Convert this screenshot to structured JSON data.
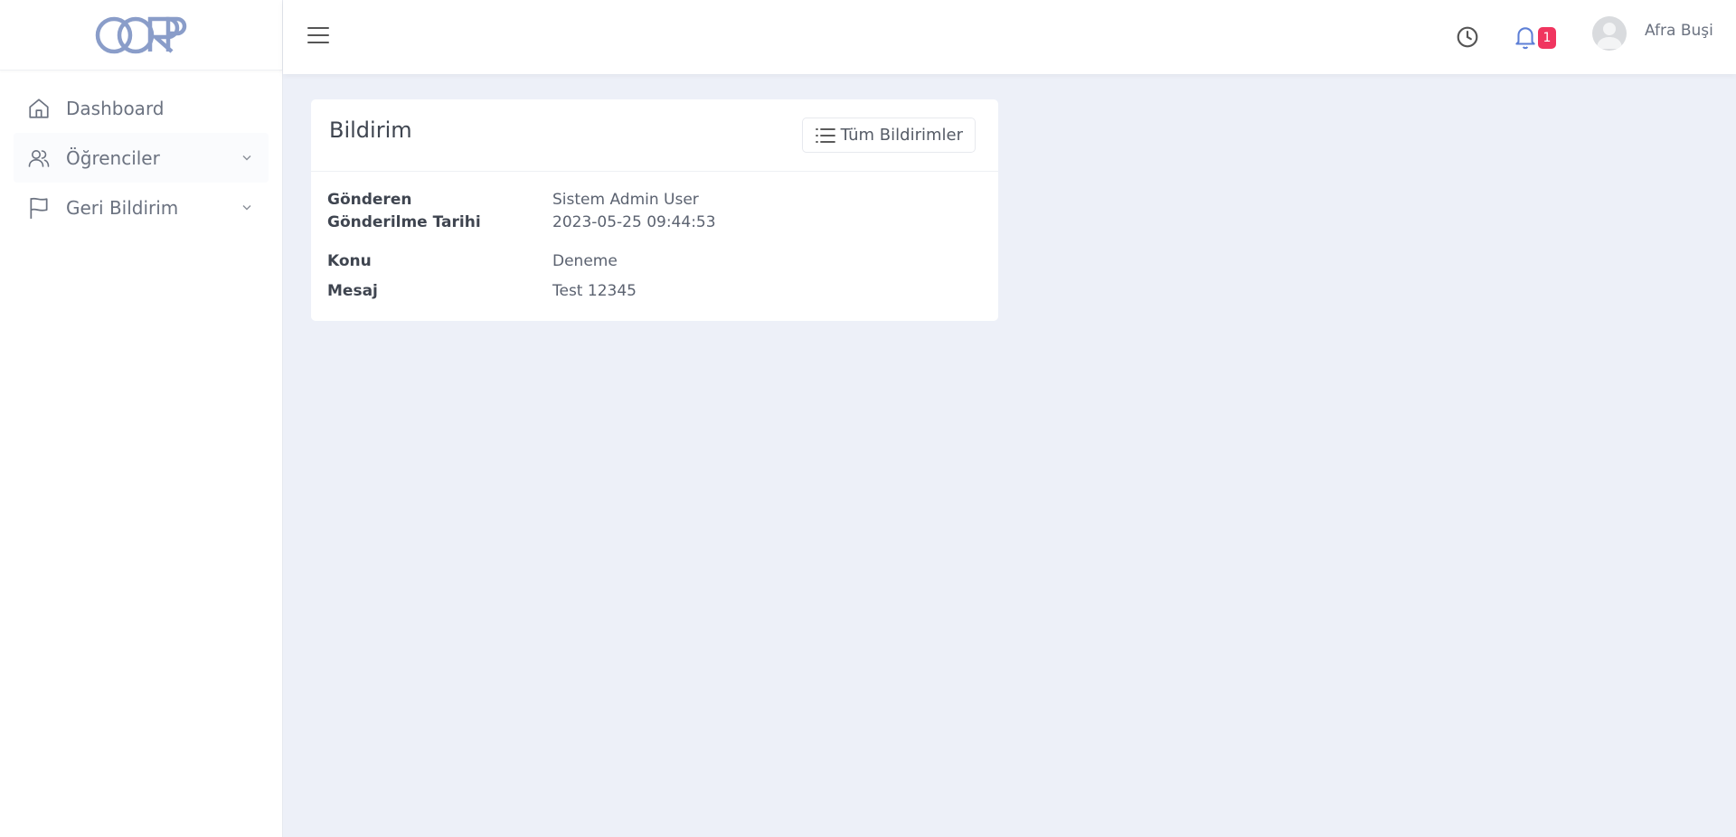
{
  "sidebar": {
    "items": [
      {
        "label": "Dashboard",
        "icon": "home-icon"
      },
      {
        "label": "Öğrenciler",
        "icon": "users-icon"
      },
      {
        "label": "Geri Bildirim",
        "icon": "flag-icon"
      }
    ]
  },
  "header": {
    "notification_count": "1",
    "user_name": "Afra Buşi"
  },
  "card": {
    "title": "Bildirim",
    "button_label": "Tüm Bildirimler",
    "fields": [
      {
        "key": "Gönderen",
        "value": "Sistem Admin User"
      },
      {
        "key": "Gönderilme Tarihi",
        "value": "2023-05-25 09:44:53"
      },
      {
        "key": "Konu",
        "value": "Deneme"
      },
      {
        "key": "Mesaj",
        "value": "Test 12345"
      }
    ]
  },
  "colors": {
    "accent": "#8a9dc9",
    "badge": "#f0355f",
    "background": "#edf0f8"
  }
}
